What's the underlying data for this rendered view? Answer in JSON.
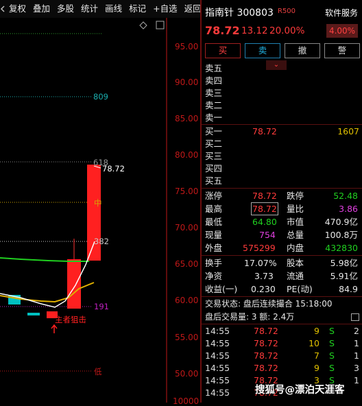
{
  "toolbar": {
    "items": [
      "复权",
      "叠加",
      "多股",
      "统计",
      "画线",
      "标记",
      "+自选",
      "返回"
    ]
  },
  "chart": {
    "price_axis": [
      "95.00",
      "90.00",
      "85.00",
      "80.00",
      "75.00",
      "70.00",
      "65.00",
      "60.00",
      "55.00",
      "50.00",
      "10000"
    ],
    "fib_labels": {
      "l809": "809",
      "l618": "618",
      "l382": "382",
      "l191": "191",
      "mid": "中",
      "low": "低"
    },
    "last_price_label": "78.72",
    "annotation": "主者狙击",
    "colors": {
      "up": "#ff2020",
      "down": "#00d0d0",
      "axis": "#c01818"
    }
  },
  "quote": {
    "name": "指南针",
    "code": "300803",
    "badge": "R500",
    "service": "软件服务",
    "price": "78.72",
    "change": "13.12",
    "change_pct": "20.00%",
    "sector_pct": "4.00%"
  },
  "actions": {
    "buy": "买",
    "sell": "卖",
    "cancel": "撤",
    "alert": "警"
  },
  "orderbook": {
    "asks": [
      "卖五",
      "卖四",
      "卖三",
      "卖二",
      "卖一"
    ],
    "bids": [
      {
        "label": "买一",
        "price": "78.72",
        "vol": "1607"
      },
      {
        "label": "买二",
        "price": "",
        "vol": ""
      },
      {
        "label": "买三",
        "price": "",
        "vol": ""
      },
      {
        "label": "买四",
        "price": "",
        "vol": ""
      },
      {
        "label": "买五",
        "price": "",
        "vol": ""
      }
    ]
  },
  "stats": {
    "row1": {
      "l1": "涨停",
      "v1": "78.72",
      "l2": "跌停",
      "v2": "52.48"
    },
    "row2": {
      "l1": "最高",
      "v1": "78.72",
      "l2": "量比",
      "v2": "3.86"
    },
    "row3": {
      "l1": "最低",
      "v1": "64.80",
      "l2": "市值",
      "v2": "470.9亿"
    },
    "row4": {
      "l1": "现量",
      "v1": "754",
      "l2": "总量",
      "v2": "100.8万"
    },
    "row5": {
      "l1": "外盘",
      "v1": "575299",
      "l2": "内盘",
      "v2": "432830"
    },
    "row6": {
      "l1": "换手",
      "v1": "17.07%",
      "l2": "股本",
      "v2": "5.98亿"
    },
    "row7": {
      "l1": "净资",
      "v1": "3.73",
      "l2": "流通",
      "v2": "5.91亿"
    },
    "row8": {
      "l1": "收益(一)",
      "v1": "0.230",
      "l2": "PE(动)",
      "v2": "84.9"
    }
  },
  "status": {
    "text": "交易状态: 盘后连续撮合 15:18:00",
    "after_hours": "盘后交易量: 3  额: 2.4万"
  },
  "ticks": [
    {
      "time": "14:55",
      "price": "78.72",
      "vol": "9",
      "side": "S",
      "n": "2"
    },
    {
      "time": "14:55",
      "price": "78.72",
      "vol": "10",
      "side": "S",
      "n": "1"
    },
    {
      "time": "14:55",
      "price": "78.72",
      "vol": "7",
      "side": "S",
      "n": "1"
    },
    {
      "time": "14:55",
      "price": "78.72",
      "vol": "9",
      "side": "S",
      "n": "3"
    },
    {
      "time": "14:55",
      "price": "78.72",
      "vol": "3",
      "side": "S",
      "n": "1"
    },
    {
      "time": "14:55",
      "price": "78.72",
      "vol": "",
      "side": "",
      "n": ""
    }
  ],
  "watermark": "搜狐号@漂泊天涯客"
}
